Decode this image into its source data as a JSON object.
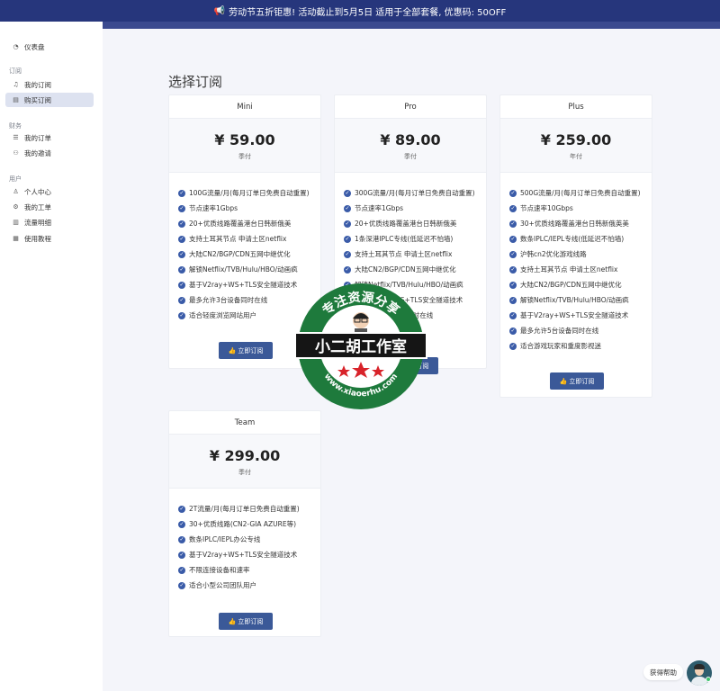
{
  "banner": {
    "text": "劳动节五折钜惠! 活动截止到5月5日 适用于全部套餐, 优惠码: 50OFF"
  },
  "sidebar": {
    "dashboard": "仪表盘",
    "groups": {
      "subscription": "订阅",
      "finance": "财务",
      "user": "用户"
    },
    "items": {
      "my_subscription": "我的订阅",
      "buy_subscription": "购买订阅",
      "my_orders": "我的订单",
      "my_invites": "我的邀请",
      "profile": "个人中心",
      "tickets": "我的工单",
      "traffic": "流量明细",
      "tutorial": "使用教程"
    }
  },
  "main": {
    "title": "选择订阅"
  },
  "plans": [
    {
      "name": "Mini",
      "price": "¥ 59.00",
      "period": "季付",
      "features": [
        "100G流量/月(每月订单日免费自动重置)",
        "节点速率1Gbps",
        "20+优质线路覆盖港台日韩新俄美",
        "支持土耳其节点 申请土区netflix",
        "大陆CN2/BGP/CDN五网中继优化",
        "解锁Netflix/TVB/Hulu/HBO/动画疯",
        "基于V2ray+WS+TLS安全隧道技术",
        "最多允许3台设备同时在线",
        "适合轻度浏览网站用户"
      ],
      "button": "立即订阅"
    },
    {
      "name": "Pro",
      "price": "¥ 89.00",
      "period": "季付",
      "features": [
        "300G流量/月(每月订单日免费自动重置)",
        "节点速率1Gbps",
        "20+优质线路覆盖港台日韩新俄美",
        "1条深港IPLC专线(低延迟不怕墙)",
        "支持土耳其节点 申请土区netflix",
        "大陆CN2/BGP/CDN五网中继优化",
        "解锁Netflix/TVB/Hulu/HBO/动画疯",
        "基于V2ray+WS+TLS安全隧道技术",
        "最多允许3台设备同时在线"
      ],
      "button": "立即订阅"
    },
    {
      "name": "Plus",
      "price": "¥ 259.00",
      "period": "年付",
      "features": [
        "500G流量/月(每月订单日免费自动重置)",
        "节点速率10Gbps",
        "30+优质线路覆盖港台日韩新俄英美",
        "数条IPLC/IEPL专线(低延迟不怕墙)",
        "沪韩cn2优化游戏线路",
        "支持土耳其节点 申请土区netflix",
        "大陆CN2/BGP/CDN五网中继优化",
        "解锁Netflix/TVB/Hulu/HBO/动画疯",
        "基于V2ray+WS+TLS安全隧道技术",
        "最多允许5台设备同时在线",
        "适合游戏玩家和重度影视迷"
      ],
      "button": "立即订阅"
    },
    {
      "name": "Team",
      "price": "¥ 299.00",
      "period": "季付",
      "features": [
        "2T流量/月(每月订单日免费自动重置)",
        "30+优质线路(CN2-GIA AZURE等)",
        "数条IPLC/IEPL办公专线",
        "基于V2ray+WS+TLS安全隧道技术",
        "不限连接设备和速率",
        "适合小型公司团队用户"
      ],
      "button": "立即订阅"
    }
  ],
  "watermark": {
    "top_text": "专注资源分享",
    "center_text": "小二胡工作室",
    "bottom_text": "www.xiaoerhu.com"
  },
  "help": {
    "label": "获得帮助"
  },
  "colors": {
    "banner": "#26367c",
    "accent": "#3b5998",
    "check": "#3a5ba8",
    "seal_green": "#1e7a3c",
    "star_red": "#d8232a"
  }
}
